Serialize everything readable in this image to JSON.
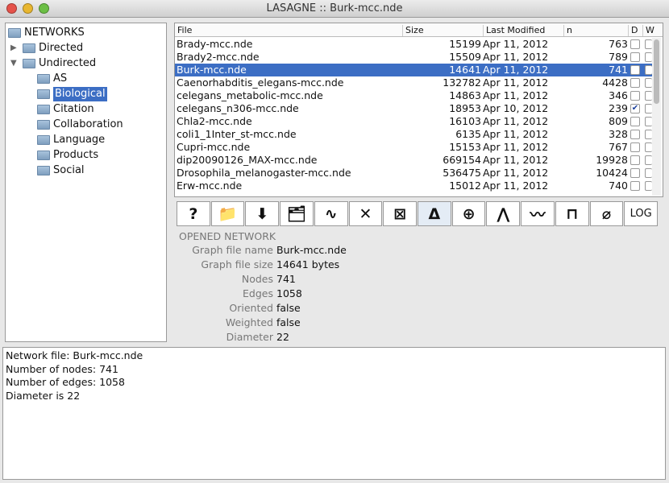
{
  "window": {
    "title": "LASAGNE :: Burk-mcc.nde"
  },
  "tree": {
    "root": "NETWORKS",
    "items": [
      {
        "label": "Directed",
        "expanded": false
      },
      {
        "label": "Undirected",
        "expanded": true
      }
    ],
    "children": [
      "AS",
      "Biological",
      "Citation",
      "Collaboration",
      "Language",
      "Products",
      "Social"
    ],
    "selected": "Biological"
  },
  "table": {
    "headers": [
      "File",
      "Size",
      "Last Modified",
      "n",
      "D",
      "W"
    ],
    "rows": [
      {
        "file": "Brady-mcc.nde",
        "size": "15199",
        "date": "Apr 11, 2012",
        "n": "763",
        "d": false
      },
      {
        "file": "Brady2-mcc.nde",
        "size": "15509",
        "date": "Apr 11, 2012",
        "n": "789",
        "d": false
      },
      {
        "file": "Burk-mcc.nde",
        "size": "14641",
        "date": "Apr 11, 2012",
        "n": "741",
        "d": false,
        "selected": true
      },
      {
        "file": "Caenorhabditis_elegans-mcc.nde",
        "size": "132782",
        "date": "Apr 11, 2012",
        "n": "4428",
        "d": false
      },
      {
        "file": "celegans_metabolic-mcc.nde",
        "size": "14863",
        "date": "Apr 11, 2012",
        "n": "346",
        "d": false
      },
      {
        "file": "celegans_n306-mcc.nde",
        "size": "18953",
        "date": "Apr 10, 2012",
        "n": "239",
        "d": true
      },
      {
        "file": "Chla2-mcc.nde",
        "size": "16103",
        "date": "Apr 11, 2012",
        "n": "809",
        "d": false
      },
      {
        "file": "coli1_1Inter_st-mcc.nde",
        "size": "6135",
        "date": "Apr 11, 2012",
        "n": "328",
        "d": false
      },
      {
        "file": "Cupri-mcc.nde",
        "size": "15153",
        "date": "Apr 11, 2012",
        "n": "767",
        "d": false
      },
      {
        "file": "dip20090126_MAX-mcc.nde",
        "size": "669154",
        "date": "Apr 11, 2012",
        "n": "19928",
        "d": false
      },
      {
        "file": "Drosophila_melanogaster-mcc.nde",
        "size": "536475",
        "date": "Apr 11, 2012",
        "n": "10424",
        "d": false
      },
      {
        "file": "Erw-mcc.nde",
        "size": "15012",
        "date": "Apr 11, 2012",
        "n": "740",
        "d": false
      }
    ]
  },
  "toolbar": [
    {
      "icon": "help-icon",
      "glyph": "?"
    },
    {
      "icon": "add-folder-icon",
      "glyph": "📁"
    },
    {
      "icon": "download-icon",
      "glyph": "⬇"
    },
    {
      "icon": "open-folder-icon",
      "glyph": "🗂"
    },
    {
      "icon": "components-icon",
      "glyph": "∿"
    },
    {
      "icon": "delete-icon",
      "glyph": "✕"
    },
    {
      "icon": "remove-box-icon",
      "glyph": "⊠"
    },
    {
      "icon": "triangle-icon",
      "glyph": "Δ"
    },
    {
      "icon": "graph-icon",
      "glyph": "⊕"
    },
    {
      "icon": "tree-icon",
      "glyph": "⋀"
    },
    {
      "icon": "plot-icon",
      "glyph": "〰"
    },
    {
      "icon": "rectangle-icon",
      "glyph": "⊓"
    },
    {
      "icon": "eraser-icon",
      "glyph": "⌀"
    },
    {
      "icon": "log-icon",
      "glyph": "LOG"
    }
  ],
  "info": {
    "heading": "OPENED NETWORK",
    "rows": [
      {
        "label": "Graph file name",
        "value": "Burk-mcc.nde"
      },
      {
        "label": "Graph file size",
        "value": "14641 bytes"
      },
      {
        "label": "Nodes",
        "value": "741"
      },
      {
        "label": "Edges",
        "value": "1058"
      },
      {
        "label": "Oriented",
        "value": "false"
      },
      {
        "label": "Weighted",
        "value": "false"
      },
      {
        "label": "Diameter",
        "value": "22"
      }
    ]
  },
  "console": [
    "Network file: Burk-mcc.nde",
    "Number of nodes: 741",
    "Number of edges: 1058",
    "Diameter is 22"
  ]
}
